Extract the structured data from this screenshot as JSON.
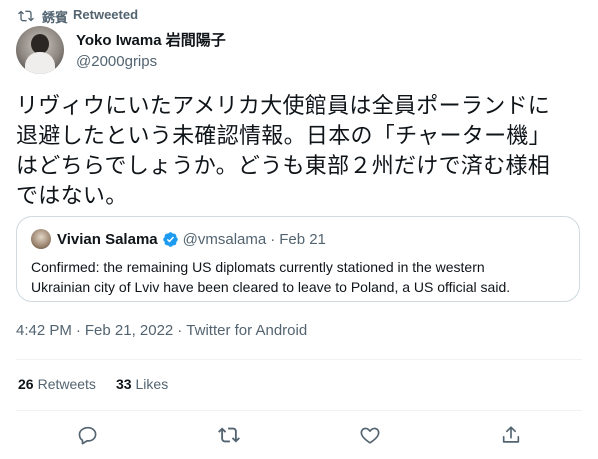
{
  "retweet": {
    "icon": "retweet-icon",
    "name": "銹賓",
    "label": "Retweeted"
  },
  "author": {
    "display_name": "Yoko Iwama 岩間陽子",
    "handle": "@2000grips",
    "avatar": "avatar-photo"
  },
  "tweet": {
    "lines": [
      "リヴィウにいたアメリカ大使館員は全員ポーランドに",
      "退避したという未確認情報。日本の「チャーター機」",
      "はどちらでしょうか。どうも東部２州だけで済む様相",
      "ではない。"
    ]
  },
  "quote": {
    "name": "Vivian Salama",
    "verified_icon": "verified-badge-icon",
    "handle": "@vmsalama",
    "separator": "·",
    "date": "Feb 21",
    "lines": [
      "Confirmed: the remaining US diplomats currently stationed in the western",
      "Ukrainian city of Lviv have been cleared to leave to Poland, a US official said."
    ]
  },
  "meta": {
    "time": "4:42 PM",
    "sep1": "·",
    "date": "Feb 21, 2022",
    "sep2": "·",
    "source": "Twitter for Android"
  },
  "stats": {
    "retweets_count": "26",
    "retweets_label": "Retweets",
    "likes_count": "33",
    "likes_label": "Likes"
  },
  "actions": [
    "reply-icon",
    "retweet-icon",
    "like-icon",
    "share-icon"
  ],
  "colors": {
    "text": "#0f1419",
    "secondary": "#536471",
    "border": "#cfd9de",
    "divider": "#eff3f4",
    "verified": "#1d9bf0"
  }
}
